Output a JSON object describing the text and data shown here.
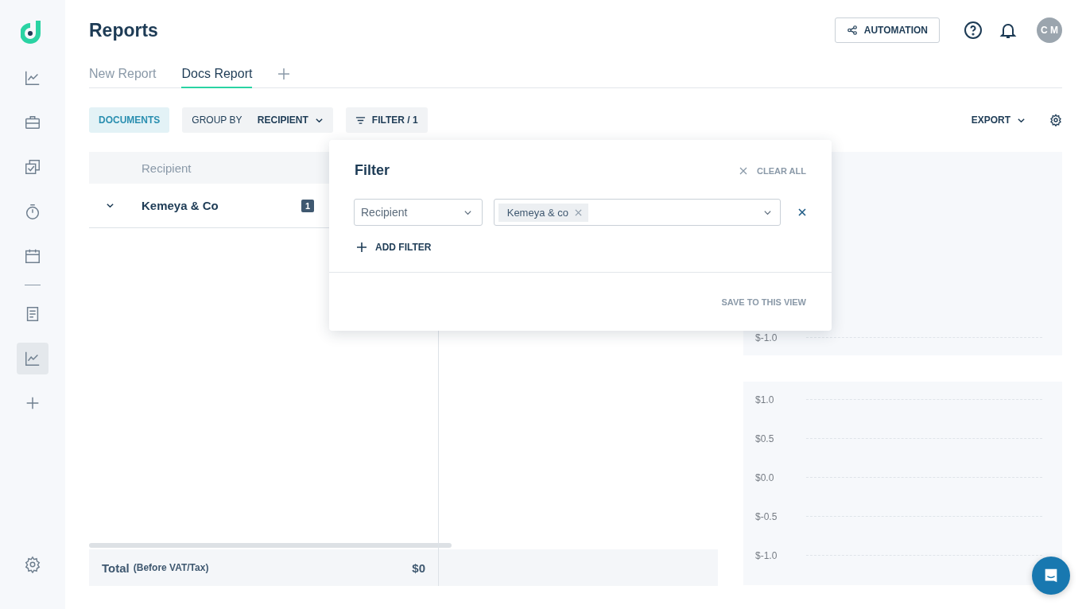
{
  "sidebar": {
    "groups": [
      [
        {
          "kind": "chart",
          "selected": false
        },
        {
          "kind": "briefcase",
          "selected": false
        },
        {
          "kind": "tasks",
          "selected": false
        },
        {
          "kind": "timer",
          "selected": false
        },
        {
          "kind": "calendar",
          "selected": false
        }
      ],
      [
        {
          "kind": "document",
          "selected": false
        },
        {
          "kind": "chart",
          "selected": true
        },
        {
          "kind": "add",
          "selected": false
        }
      ]
    ]
  },
  "header": {
    "title": "Reports",
    "automation": "AUTOMATION",
    "avatar": "C M"
  },
  "tabs": [
    {
      "label": "New Report",
      "selected": false
    },
    {
      "label": "Docs Report",
      "selected": true
    }
  ],
  "toolbar": {
    "documents": {
      "label": "DOCUMENTS",
      "selected": true
    },
    "group_by": {
      "label": "GROUP BY",
      "value": "RECIPIENT"
    },
    "filter": "FILTER / 1",
    "export": "EXPORT"
  },
  "table": {
    "column": "Recipient",
    "rows": [
      {
        "name": "Kemeya & Co",
        "count": "1",
        "expanded": true
      }
    ],
    "total": {
      "label": "Total",
      "note": "(Before VAT/Tax)",
      "value": "$0"
    }
  },
  "filter_popover": {
    "title": "Filter",
    "clear_all": "CLEAR ALL",
    "rules": [
      {
        "field": "Recipient",
        "values": [
          "Kemeya & co"
        ]
      }
    ],
    "add_filter": "ADD FILTER",
    "save": "SAVE TO THIS VIEW"
  },
  "charts": [
    {
      "axis_labels": [
        "$-1.0"
      ]
    },
    {
      "axis_labels": [
        "$1.0",
        "$0.5",
        "$0.0",
        "$-0.5",
        "$-1.0"
      ]
    }
  ]
}
